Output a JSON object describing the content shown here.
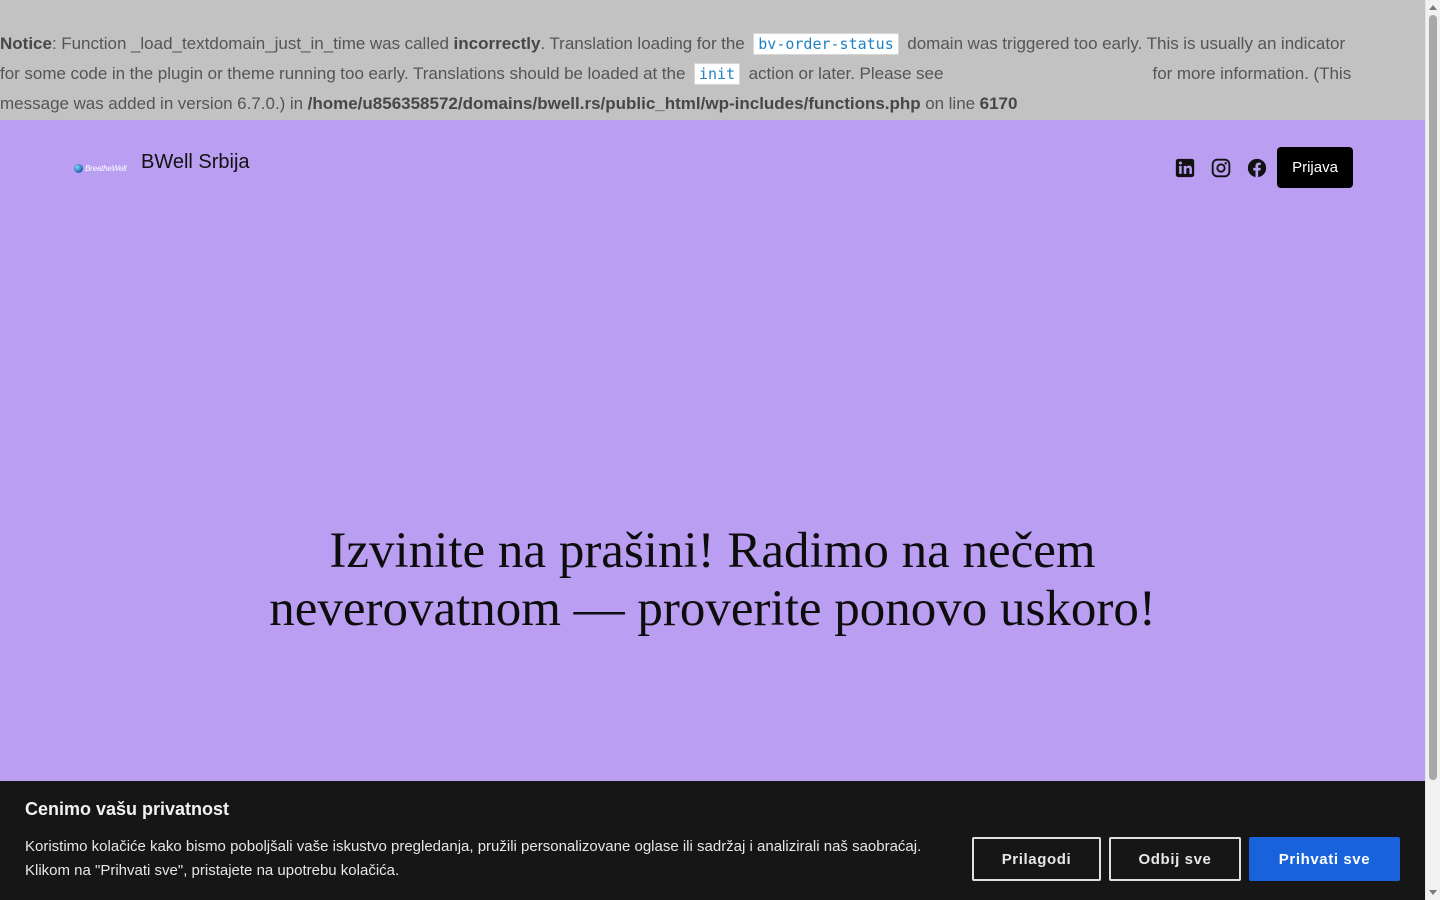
{
  "notice": {
    "label": "Notice",
    "part1": ": Function _load_textdomain_just_in_time was called ",
    "strong1": "incorrectly",
    "part2": ". Translation loading for the ",
    "code1": "bv-order-status",
    "part3": " domain was triggered too early. This is usually an indicator for some code in the plugin or theme running too early. Translations should be loaded at the ",
    "code2": "init",
    "part4": " action or later. Please see ",
    "part5": " for more information. (This message was added in version 6.7.0.) in ",
    "path": "/home/u856358572/domains/bwell.rs/public_html/wp-includes/functions.php",
    "part6": " on line ",
    "line": "6170"
  },
  "header": {
    "logo_text": "BreatheWell",
    "site_title": "BWell Srbija",
    "social": [
      "linkedin-icon",
      "instagram-icon",
      "facebook-icon"
    ],
    "login_label": "Prijava"
  },
  "hero": {
    "headline": "Izvinite na prašini! Radimo na nečem neverovatnom — proverite ponovo uskoro!",
    "background_color": "#b99ef2"
  },
  "cookie_banner": {
    "title": "Cenimo vašu privatnost",
    "text": "Koristimo kolačiće kako bismo poboljšali vaše iskustvo pregledanja, pružili personalizovane oglase ili sadržaj i analizirali naš saobraćaj. Klikom na \"Prihvati sve\", pristajete na upotrebu kolačića.",
    "customize_label": "Prilagodi",
    "reject_label": "Odbij sve",
    "accept_label": "Prihvati sve",
    "accent_color": "#1863dc"
  }
}
